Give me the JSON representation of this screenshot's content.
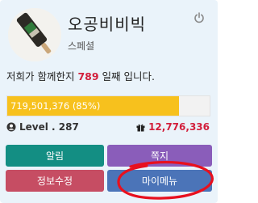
{
  "profile": {
    "name": "오공비비빅",
    "subtitle": "스페셜",
    "days_prefix": "저희가 함께한지 ",
    "days_count": "789",
    "days_suffix": " 일째 입니다."
  },
  "progress": {
    "label": "719,501,376 (85%)",
    "percent": 85,
    "color": "#f7c11d"
  },
  "level": {
    "label": "Level . 287",
    "icon": "user-icon"
  },
  "points": {
    "value": "12,776,336",
    "icon": "gift-icon",
    "color": "#d21f3c"
  },
  "buttons": {
    "alarm": "알림",
    "memo": "쪽지",
    "edit": "정보수정",
    "mymenu": "마이메뉴"
  },
  "colors": {
    "alarm": "#138e83",
    "memo": "#8a5dba",
    "edit": "#c64d63",
    "mymenu": "#4b74b8",
    "annotation": "#e8101e"
  },
  "icons": {
    "power": "power-icon"
  }
}
